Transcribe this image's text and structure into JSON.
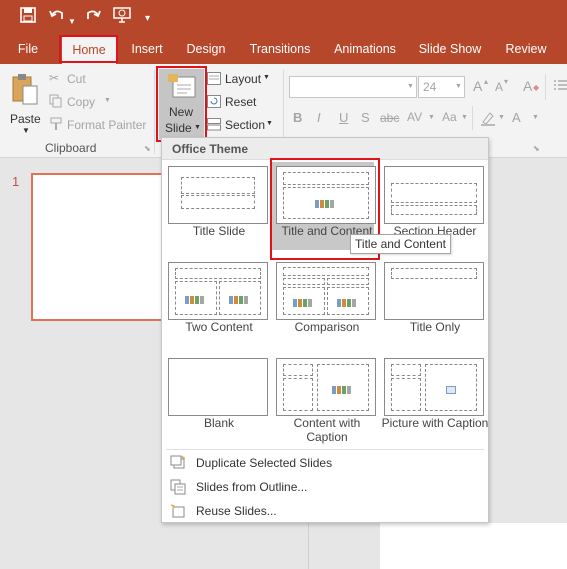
{
  "qat": {
    "save": "save-icon",
    "undo": "undo-icon",
    "redo": "redo-icon",
    "present": "present-icon",
    "more": "customize-icon"
  },
  "tabs": [
    "File",
    "Home",
    "Insert",
    "Design",
    "Transitions",
    "Animations",
    "Slide Show",
    "Review"
  ],
  "active_tab": "Home",
  "clipboard": {
    "paste": "Paste",
    "cut": "Cut",
    "copy": "Copy",
    "format_painter": "Format Painter",
    "group": "Clipboard"
  },
  "slides": {
    "new_slide_line1": "New",
    "new_slide_line2": "Slide",
    "layout": "Layout",
    "reset": "Reset",
    "section": "Section"
  },
  "font": {
    "name": "",
    "size": "24",
    "bold": "B",
    "italic": "I",
    "underline": "U",
    "shadow": "S",
    "strike": "abc",
    "grow": "A",
    "shrink": "A",
    "clear": "A"
  },
  "thumbnail": {
    "number": "1"
  },
  "gallery": {
    "header": "Office Theme",
    "layouts": [
      "Title Slide",
      "Title and Content",
      "Section Header",
      "Two Content",
      "Comparison",
      "Title Only",
      "Blank",
      "Content with Caption",
      "Picture with Caption"
    ],
    "selected": "Title and Content"
  },
  "menu": [
    "Duplicate Selected Slides",
    "Slides from Outline...",
    "Reuse Slides..."
  ],
  "tooltip": "Title and Content",
  "colors": {
    "accent": "#b7472a",
    "highlight": "#e0131b"
  }
}
